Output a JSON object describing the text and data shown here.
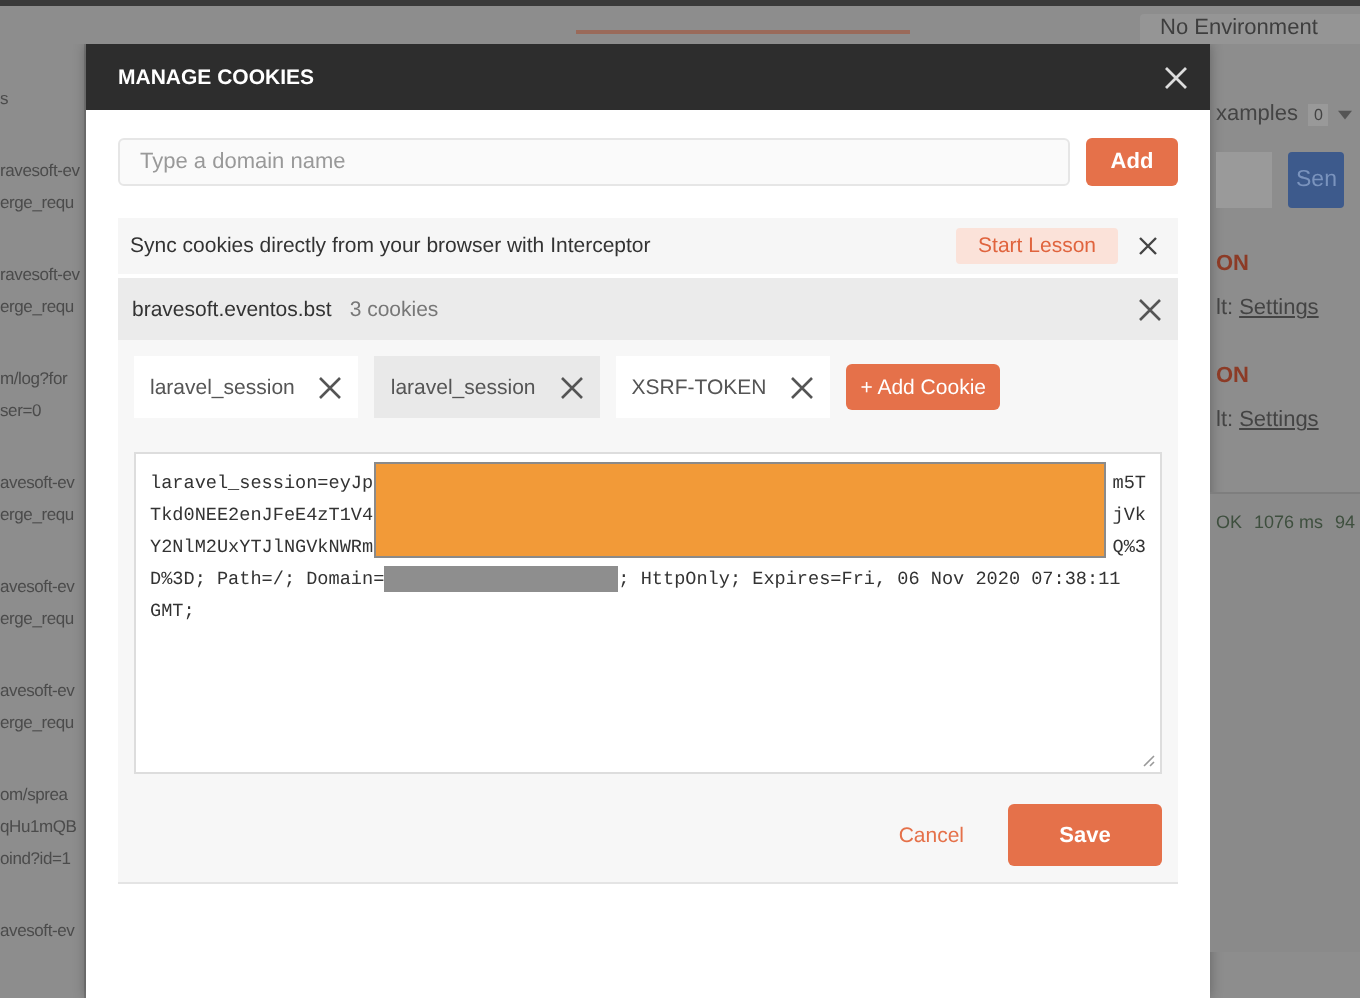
{
  "background": {
    "environment": "No Environment",
    "left_list": [
      [
        "s"
      ],
      [
        "ravesoft-ev",
        "erge_requ"
      ],
      [
        "ravesoft-ev",
        "erge_requ"
      ],
      [
        "m/log?for",
        "ser=0"
      ],
      [
        "avesoft-ev",
        "erge_requ"
      ],
      [
        "avesoft-ev",
        "erge_requ"
      ],
      [
        "avesoft-ev",
        "erge_requ"
      ],
      [
        "om/sprea",
        "qHu1mQB",
        "oind?id=1"
      ],
      [
        "avesoft-ev"
      ]
    ],
    "examples": {
      "label": "xamples",
      "count": "0"
    },
    "send_button": "Sen",
    "right_items": [
      {
        "kind": "heading",
        "text": "ON"
      },
      {
        "kind": "setting",
        "prefix": "lt:",
        "link": "Settings"
      },
      {
        "kind": "heading",
        "text": "ON"
      },
      {
        "kind": "setting",
        "prefix": "lt:",
        "link": "Settings"
      }
    ],
    "response": {
      "status": "OK",
      "time": "1076 ms",
      "size": "94"
    }
  },
  "modal": {
    "title": "MANAGE COOKIES",
    "domain_field": {
      "placeholder": "Type a domain name"
    },
    "add_button": "Add",
    "interceptor": {
      "text": "Sync cookies directly from your browser with Interceptor",
      "button": "Start Lesson"
    },
    "domain": {
      "name": "bravesoft.eventos.bst",
      "count": "3 cookies"
    },
    "cookies": [
      {
        "name": "laravel_session",
        "selected": false
      },
      {
        "name": "laravel_session",
        "selected": true
      },
      {
        "name": "XSRF-TOKEN",
        "selected": false
      }
    ],
    "add_cookie_button": "+ Add Cookie",
    "value_lines": [
      {
        "kind": "split",
        "left": "laravel_session=eyJp",
        "right": "m5T"
      },
      {
        "kind": "split",
        "left": "Tkd0NEE2enJFeE4zT1V4",
        "right": "jVk"
      },
      {
        "kind": "split",
        "left": "Y2NlM2UxYTJlNGVkNWRm",
        "right": "Q%3"
      },
      {
        "kind": "masked",
        "left": "D%3D; Path=/; Domain=",
        "right": "; HttpOnly; Expires=Fri, 06 Nov 2020 07:38:11"
      },
      {
        "kind": "plain",
        "left": "GMT;"
      }
    ],
    "cancel_button": "Cancel",
    "save_button": "Save"
  }
}
